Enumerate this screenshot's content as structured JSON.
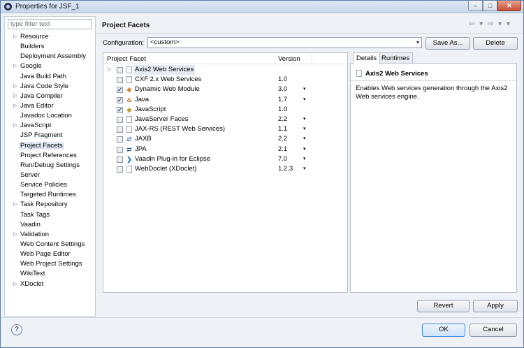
{
  "window": {
    "title": "Properties for JSF_1",
    "min_glyph": "–",
    "max_glyph": "□",
    "close_glyph": "✕"
  },
  "filter": {
    "placeholder": "type filter text"
  },
  "nav": {
    "items": [
      {
        "label": "Resource",
        "expandable": true
      },
      {
        "label": "Builders",
        "expandable": false
      },
      {
        "label": "Deployment Assembly",
        "expandable": false
      },
      {
        "label": "Google",
        "expandable": true
      },
      {
        "label": "Java Build Path",
        "expandable": false
      },
      {
        "label": "Java Code Style",
        "expandable": true
      },
      {
        "label": "Java Compiler",
        "expandable": true
      },
      {
        "label": "Java Editor",
        "expandable": true
      },
      {
        "label": "Javadoc Location",
        "expandable": false
      },
      {
        "label": "JavaScript",
        "expandable": true
      },
      {
        "label": "JSP Fragment",
        "expandable": false
      },
      {
        "label": "Project Facets",
        "expandable": false,
        "selected": true
      },
      {
        "label": "Project References",
        "expandable": false
      },
      {
        "label": "Run/Debug Settings",
        "expandable": false
      },
      {
        "label": "Server",
        "expandable": false
      },
      {
        "label": "Service Policies",
        "expandable": false
      },
      {
        "label": "Targeted Runtimes",
        "expandable": false
      },
      {
        "label": "Task Repository",
        "expandable": true
      },
      {
        "label": "Task Tags",
        "expandable": false
      },
      {
        "label": "Vaadin",
        "expandable": false
      },
      {
        "label": "Validation",
        "expandable": true
      },
      {
        "label": "Web Content Settings",
        "expandable": false
      },
      {
        "label": "Web Page Editor",
        "expandable": false
      },
      {
        "label": "Web Project Settings",
        "expandable": false
      },
      {
        "label": "WikiText",
        "expandable": false
      },
      {
        "label": "XDoclet",
        "expandable": true
      }
    ]
  },
  "page": {
    "title": "Project Facets",
    "nav_arrows": "⇦ ▾ ⇨ ▾ ▾"
  },
  "configuration": {
    "label": "Configuration:",
    "value": "<custom>",
    "save_as_label": "Save As...",
    "delete_label": "Delete"
  },
  "facets": {
    "col_facet": "Project Facet",
    "col_version": "Version",
    "rows": [
      {
        "name": "Axis2 Web Services",
        "version": "",
        "checked": false,
        "icon": "doc",
        "expander": true,
        "dropdown": false,
        "selected": true
      },
      {
        "name": "CXF 2.x Web Services",
        "version": "1.0",
        "checked": false,
        "icon": "doc",
        "expander": false,
        "dropdown": false
      },
      {
        "name": "Dynamic Web Module",
        "version": "3.0",
        "checked": true,
        "icon": "web",
        "expander": false,
        "dropdown": true
      },
      {
        "name": "Java",
        "version": "1.7",
        "checked": true,
        "icon": "java",
        "expander": false,
        "dropdown": true
      },
      {
        "name": "JavaScript",
        "version": "1.0",
        "checked": true,
        "icon": "js",
        "expander": false,
        "dropdown": false
      },
      {
        "name": "JavaServer Faces",
        "version": "2.2",
        "checked": false,
        "icon": "doc",
        "expander": false,
        "dropdown": true
      },
      {
        "name": "JAX-RS (REST Web Services)",
        "version": "1.1",
        "checked": false,
        "icon": "doc",
        "expander": false,
        "dropdown": true
      },
      {
        "name": "JAXB",
        "version": "2.2",
        "checked": false,
        "icon": "jaxb",
        "expander": false,
        "dropdown": true
      },
      {
        "name": "JPA",
        "version": "2.1",
        "checked": false,
        "icon": "jaxb",
        "expander": false,
        "dropdown": true
      },
      {
        "name": "Vaadin Plug-in for Eclipse",
        "version": "7.0",
        "checked": false,
        "icon": "vaadin",
        "expander": false,
        "dropdown": true
      },
      {
        "name": "WebDoclet (XDoclet)",
        "version": "1.2.3",
        "checked": false,
        "icon": "doc",
        "expander": false,
        "dropdown": true
      }
    ]
  },
  "icons": {
    "doc": "",
    "web": "◈",
    "java": "♨",
    "js": "◈",
    "jaxb": "⇄",
    "vaadin": "❯"
  },
  "tabs": {
    "details": "Details",
    "runtimes": "Runtimes"
  },
  "details": {
    "title": "Axis2 Web Services",
    "description": "Enables Web services generation through the Axis2 Web services engine."
  },
  "buttons": {
    "revert": "Revert",
    "apply": "Apply",
    "ok": "OK",
    "cancel": "Cancel",
    "help": "?"
  },
  "glyphs": {
    "expander": "▷",
    "check": "✓",
    "dropdown": "▾"
  }
}
